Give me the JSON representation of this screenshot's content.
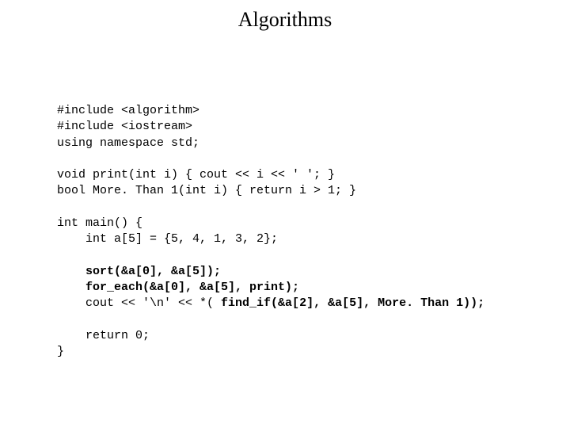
{
  "title": "Algorithms",
  "code": {
    "l1": "#include <algorithm>",
    "l2": "#include <iostream>",
    "l3": "using namespace std;",
    "l4": "",
    "l5": "void print(int i) { cout << i << ' '; }",
    "l6": "bool More. Than 1(int i) { return i > 1; }",
    "l7": "",
    "l8": "int main() {",
    "l9": "    int a[5] = {5, 4, 1, 3, 2};",
    "l10": "",
    "l11a": "    ",
    "l11b": "sort(&a[0], &a[5]);",
    "l12a": "    ",
    "l12b": "for_each(&a[0], &a[5], print);",
    "l13a": "    cout << '\\n' << *( ",
    "l13b": "find_if(&a[2], &a[5], More. Than 1));",
    "l14": "",
    "l15": "    return 0;",
    "l16": "}"
  }
}
